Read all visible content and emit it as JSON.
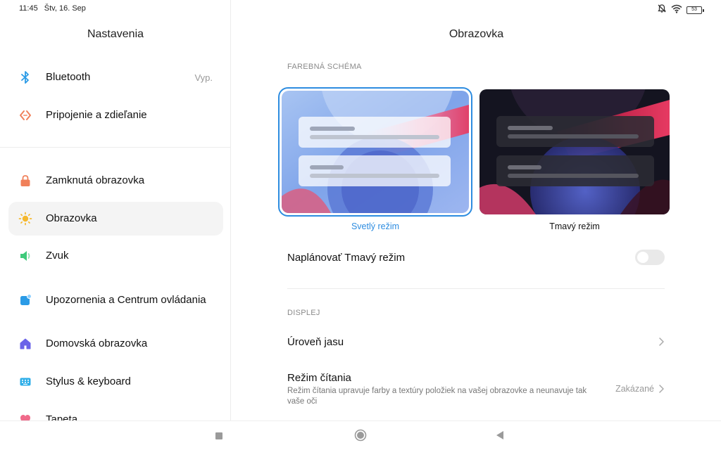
{
  "status_bar": {
    "time": "11:45",
    "date": "Štv, 16. Sep",
    "battery": "53",
    "icons": [
      "bell-off-icon",
      "wifi-icon",
      "battery-icon"
    ]
  },
  "left_pane": {
    "title": "Nastavenia",
    "items": [
      {
        "label": "Bluetooth",
        "value": "Vyp.",
        "icon": "bluetooth-icon",
        "color": "#2b9be6"
      },
      {
        "label": "Pripojenie a zdieľanie",
        "icon": "connection-share-icon",
        "color": "#f0805a"
      },
      {
        "label": "Zamknutá obrazovka",
        "icon": "lock-icon",
        "color": "#f0805a"
      },
      {
        "label": "Obrazovka",
        "icon": "sun-icon",
        "color": "#f5b82e",
        "active": true
      },
      {
        "label": "Zvuk",
        "icon": "speaker-icon",
        "color": "#3fca7a"
      },
      {
        "label": "Upozornenia a Centrum ovládania",
        "icon": "notification-icon",
        "color": "#2b9be6"
      },
      {
        "label": "Domovská obrazovka",
        "icon": "home-icon",
        "color": "#6a63e8"
      },
      {
        "label": "Stylus & keyboard",
        "icon": "keyboard-icon",
        "color": "#2eaee8"
      },
      {
        "label": "Tapeta",
        "icon": "wallpaper-icon",
        "color": "#f06a8a"
      }
    ]
  },
  "right_pane": {
    "title": "Obrazovka",
    "color_scheme": {
      "header": "FAREBNÁ SCHÉMA",
      "light_label": "Svetlý režim",
      "dark_label": "Tmavý režim",
      "selected": "light",
      "accent_color": "#2d8ce0"
    },
    "schedule_dark": {
      "label": "Naplánovať Tmavý režim",
      "enabled": false
    },
    "display": {
      "header": "DISPLEJ",
      "brightness_label": "Úroveň jasu",
      "reading_mode": {
        "label": "Režim čítania",
        "description": "Režim čítania upravuje farby a textúry položiek na vašej obrazovke a neunavuje tak vaše oči",
        "value": "Zakázané"
      }
    }
  },
  "nav_bar": {
    "buttons": [
      "recents-button",
      "home-button",
      "back-button"
    ]
  }
}
